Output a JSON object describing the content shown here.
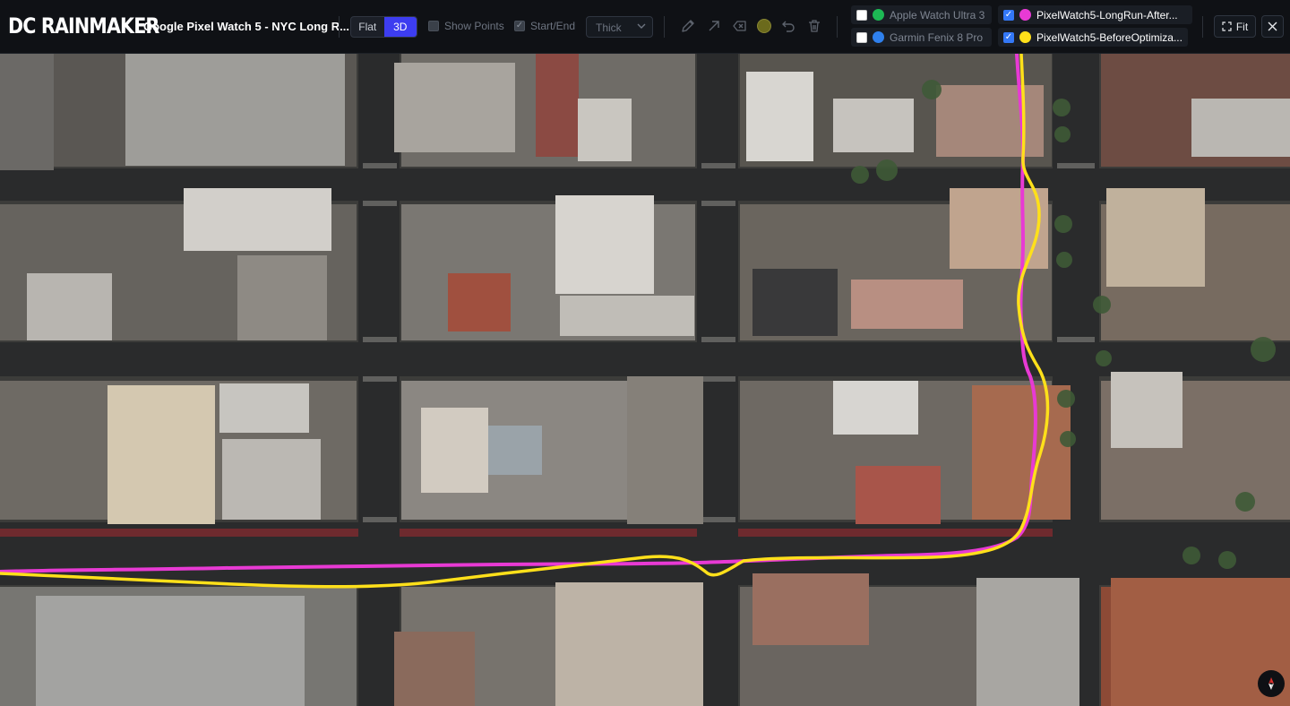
{
  "header": {
    "logo": "DC RAINMAKER",
    "title": "Google Pixel Watch 5 - NYC Long R..."
  },
  "view_toggle": {
    "flat_label": "Flat",
    "threed_label": "3D",
    "selected": "3D"
  },
  "options": {
    "show_points": {
      "label": "Show Points",
      "checked": false
    },
    "start_end": {
      "label": "Start/End",
      "checked": true
    },
    "line_weight": {
      "selected": "Thick"
    }
  },
  "tools": [
    "pencil-icon",
    "arrow-icon",
    "eraser-icon",
    "color-swatch",
    "undo-icon",
    "trash-icon"
  ],
  "tool_color": "#6b6a1c",
  "tracks": [
    {
      "label": "Apple Watch Ultra 3",
      "checked": false,
      "color": "#1db954"
    },
    {
      "label": "Garmin Fenix 8 Pro",
      "checked": false,
      "color": "#2f80ed"
    },
    {
      "label": "PixelWatch5-LongRun-After...",
      "checked": true,
      "color": "#e83ad4"
    },
    {
      "label": "PixelWatch5-BeforeOptimiza...",
      "checked": true,
      "color": "#ffe01a"
    }
  ],
  "buttons": {
    "fit_label": "Fit"
  },
  "map": {
    "view": "3D satellite imagery",
    "visible_tracks": [
      "PixelWatch5-LongRun-After...",
      "PixelWatch5-BeforeOptimiza..."
    ]
  }
}
